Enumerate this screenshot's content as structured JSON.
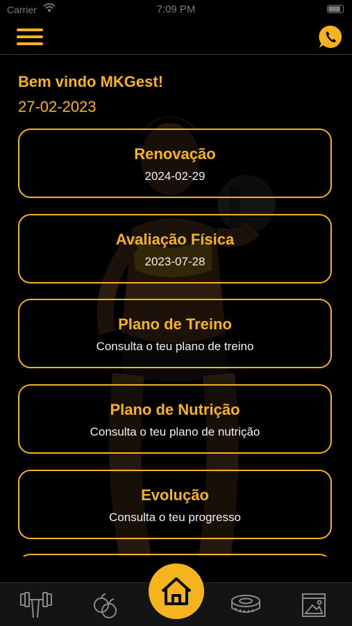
{
  "status_bar": {
    "carrier": "Carrier",
    "time": "7:09 PM"
  },
  "header": {
    "welcome": "Bem vindo MKGest!",
    "date": "27-02-2023"
  },
  "cards": [
    {
      "title": "Renovação",
      "subtitle": "2024-02-29"
    },
    {
      "title": "Avaliação Física",
      "subtitle": "2023-07-28"
    },
    {
      "title": "Plano de Treino",
      "subtitle": "Consulta o teu plano de treino"
    },
    {
      "title": "Plano de Nutrição",
      "subtitle": "Consulta o teu plano de nutrição"
    },
    {
      "title": "Evolução",
      "subtitle": "Consulta o teu progresso"
    }
  ],
  "tabs": [
    "dumbbell-icon",
    "fruit-icon",
    "home-icon",
    "measuring-tape-icon",
    "gallery-icon"
  ],
  "colors": {
    "accent": "#f5b41e",
    "background": "#000000",
    "tab_bar": "#141414"
  }
}
